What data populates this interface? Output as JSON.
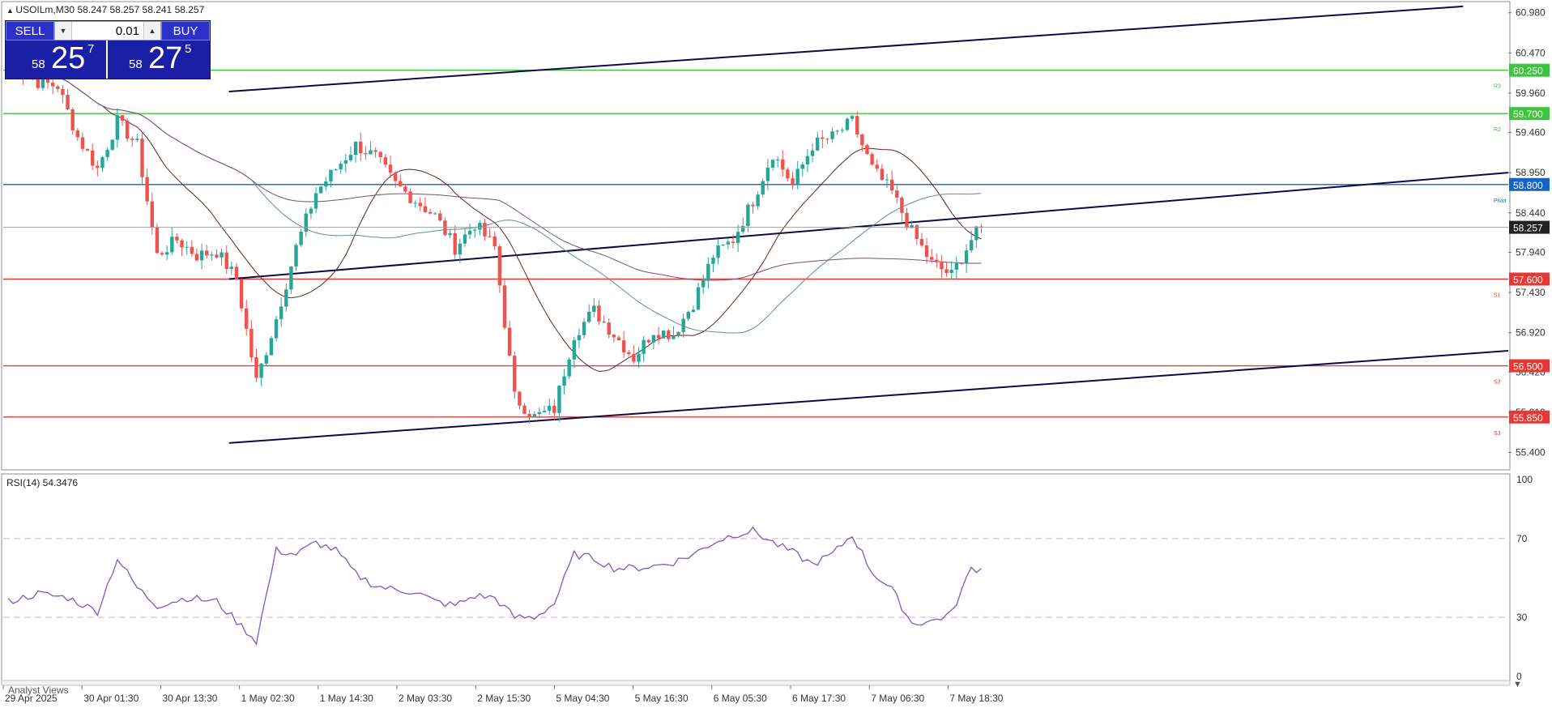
{
  "header": {
    "symbol": "USOILm,M30",
    "ohlc": "58.247 58.257 58.241 58.257"
  },
  "trade_panel": {
    "sell_label": "SELL",
    "buy_label": "BUY",
    "lot": "0.01",
    "sell_price_prefix": "58",
    "sell_price_big": "25",
    "sell_price_sup": "7",
    "buy_price_prefix": "58",
    "buy_price_big": "27",
    "buy_price_sup": "5"
  },
  "price_axis": {
    "ticks": [
      "60.980",
      "60.470",
      "59.960",
      "59.460",
      "58.950",
      "58.440",
      "57.940",
      "57.430",
      "56.920",
      "56.420",
      "55.910",
      "55.400"
    ]
  },
  "levels": [
    {
      "price": "60.250",
      "label": "R3",
      "color": "#3ec43e"
    },
    {
      "price": "59.700",
      "label": "R2",
      "color": "#3ec43e"
    },
    {
      "price": "58.800",
      "label": "Pivot",
      "color": "#1565c0"
    },
    {
      "price": "57.600",
      "label": "S1",
      "color": "#e53935"
    },
    {
      "price": "56.500",
      "label": "S2",
      "color": "#e53935"
    },
    {
      "price": "55.850",
      "label": "S3",
      "color": "#e53935"
    }
  ],
  "current_price": "58.257",
  "rsi": {
    "label": "RSI(14) 54.3476",
    "ticks": [
      "100",
      "70",
      "30",
      "0"
    ]
  },
  "bottom_label": "Analyst Views",
  "time_axis": [
    "29 Apr 2025",
    "30 Apr 01:30",
    "30 Apr 13:30",
    "1 May 02:30",
    "1 May 14:30",
    "2 May 03:30",
    "2 May 15:30",
    "5 May 04:30",
    "5 May 16:30",
    "6 May 05:30",
    "6 May 17:30",
    "7 May 06:30",
    "7 May 18:30"
  ],
  "colors": {
    "bull": "#26a69a",
    "bear": "#ef5350",
    "channel": "#0b0b4a",
    "rsi_line": "#7e57c2",
    "panel": "#1a1fa6"
  },
  "chart_data": {
    "type": "candlestick",
    "price_range": [
      55.2,
      61.1
    ],
    "close_path": [
      [
        0,
        60.35
      ],
      [
        6,
        60.1
      ],
      [
        10,
        60.05
      ],
      [
        14,
        59.4
      ],
      [
        18,
        59.0
      ],
      [
        22,
        59.6
      ],
      [
        26,
        59.3
      ],
      [
        30,
        57.9
      ],
      [
        34,
        58.1
      ],
      [
        38,
        57.9
      ],
      [
        42,
        57.95
      ],
      [
        46,
        57.6
      ],
      [
        50,
        56.3
      ],
      [
        54,
        57.1
      ],
      [
        58,
        58.0
      ],
      [
        62,
        58.7
      ],
      [
        66,
        59.0
      ],
      [
        70,
        59.3
      ],
      [
        74,
        59.15
      ],
      [
        78,
        58.8
      ],
      [
        82,
        58.6
      ],
      [
        86,
        58.4
      ],
      [
        90,
        58.0
      ],
      [
        94,
        58.3
      ],
      [
        98,
        58.0
      ],
      [
        102,
        56.1
      ],
      [
        106,
        55.85
      ],
      [
        110,
        55.95
      ],
      [
        114,
        56.9
      ],
      [
        118,
        57.2
      ],
      [
        122,
        56.9
      ],
      [
        126,
        56.6
      ],
      [
        130,
        56.95
      ],
      [
        134,
        56.9
      ],
      [
        138,
        57.3
      ],
      [
        142,
        57.9
      ],
      [
        146,
        58.1
      ],
      [
        150,
        58.6
      ],
      [
        154,
        59.2
      ],
      [
        158,
        58.8
      ],
      [
        162,
        59.3
      ],
      [
        166,
        59.4
      ],
      [
        170,
        59.6
      ],
      [
        174,
        59.0
      ],
      [
        178,
        58.7
      ],
      [
        182,
        58.2
      ],
      [
        186,
        57.8
      ],
      [
        190,
        57.65
      ],
      [
        194,
        58.1
      ],
      [
        196,
        58.26
      ]
    ],
    "channel_lines": [
      {
        "from": [
          0.15,
          59.98
        ],
        "to": [
          0.97,
          61.06
        ]
      },
      {
        "from": [
          0.15,
          57.6
        ],
        "to": [
          1.0,
          58.95
        ]
      },
      {
        "from": [
          0.15,
          55.52
        ],
        "to": [
          1.0,
          56.69
        ]
      }
    ],
    "rsi_path": [
      [
        0,
        38
      ],
      [
        6,
        42
      ],
      [
        12,
        40
      ],
      [
        18,
        33
      ],
      [
        22,
        60
      ],
      [
        26,
        45
      ],
      [
        30,
        36
      ],
      [
        36,
        40
      ],
      [
        42,
        38
      ],
      [
        46,
        28
      ],
      [
        50,
        18
      ],
      [
        54,
        64
      ],
      [
        58,
        62
      ],
      [
        62,
        68
      ],
      [
        66,
        64
      ],
      [
        70,
        52
      ],
      [
        74,
        46
      ],
      [
        78,
        44
      ],
      [
        82,
        43
      ],
      [
        86,
        38
      ],
      [
        90,
        36
      ],
      [
        94,
        41
      ],
      [
        98,
        40
      ],
      [
        102,
        30
      ],
      [
        106,
        30
      ],
      [
        110,
        37
      ],
      [
        114,
        62
      ],
      [
        118,
        60
      ],
      [
        122,
        55
      ],
      [
        126,
        55
      ],
      [
        130,
        56
      ],
      [
        134,
        58
      ],
      [
        138,
        62
      ],
      [
        142,
        68
      ],
      [
        146,
        72
      ],
      [
        150,
        74
      ],
      [
        154,
        68
      ],
      [
        158,
        63
      ],
      [
        162,
        57
      ],
      [
        166,
        62
      ],
      [
        170,
        72
      ],
      [
        174,
        53
      ],
      [
        178,
        44
      ],
      [
        182,
        27
      ],
      [
        186,
        28
      ],
      [
        190,
        32
      ],
      [
        194,
        55
      ],
      [
        196,
        54.35
      ]
    ]
  }
}
